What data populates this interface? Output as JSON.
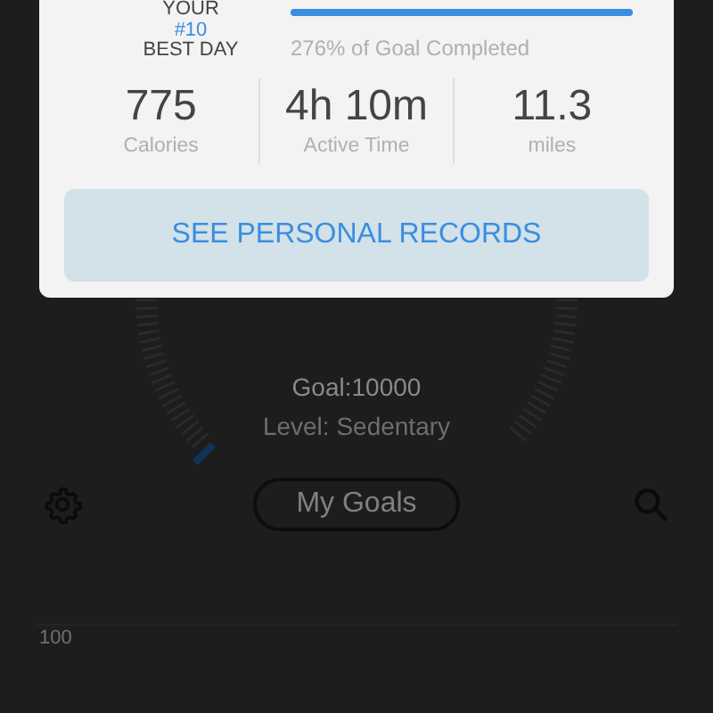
{
  "background": {
    "goal": "Goal:10000",
    "level_text": "Level: Sedentary",
    "goals_button": "My Goals",
    "chart_axis_label": "100"
  },
  "dialog": {
    "rank": {
      "prefix": "YOUR",
      "value": "#10",
      "suffix": "BEST DAY"
    },
    "goal_progress": {
      "level": 1,
      "caption": "276% of Goal Completed"
    },
    "stats": [
      {
        "value": "775",
        "label": "Calories"
      },
      {
        "value": "4h 10m",
        "label": "Active Time"
      },
      {
        "value": "11.3",
        "label": "miles"
      }
    ],
    "button": "SEE PERSONAL RECORDS"
  }
}
